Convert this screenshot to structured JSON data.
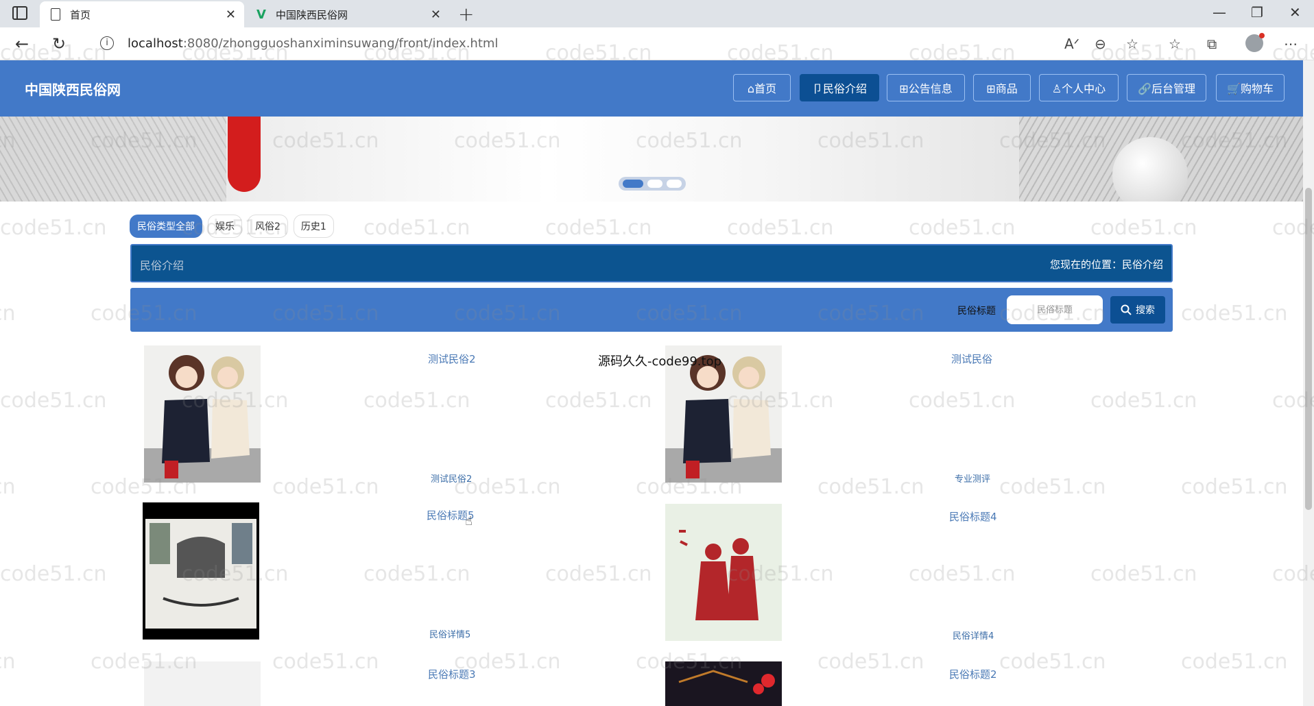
{
  "browser": {
    "tabs": [
      {
        "label": "首页",
        "active": true
      },
      {
        "label": "中国陕西民俗网",
        "active": false
      }
    ],
    "url_host": "localhost",
    "url_rest": ":8080/zhongguoshanximinsuwang/front/index.html"
  },
  "site": {
    "title": "中国陕西民俗网",
    "nav": [
      {
        "label": "⌂首页",
        "icon": "home-icon"
      },
      {
        "label": "卩民俗介绍",
        "icon": "flag-icon",
        "active": true
      },
      {
        "label": "⊞公告信息",
        "icon": "notice-icon"
      },
      {
        "label": "⊞商品",
        "icon": "shop-icon"
      },
      {
        "label": "♙个人中心",
        "icon": "user-icon"
      },
      {
        "label": "🔗后台管理",
        "icon": "link-icon"
      },
      {
        "label": "🛒购物车",
        "icon": "cart-icon"
      }
    ],
    "accent": "#4279c8",
    "accent_dark": "#0c4f93"
  },
  "banner": {
    "slides": 3,
    "current": 1
  },
  "types": [
    "民俗类型全部",
    "娱乐",
    "风俗2",
    "历史1"
  ],
  "section": {
    "title": "民俗介绍",
    "location_label": "您现在的位置：",
    "location_value": "民俗介绍"
  },
  "search": {
    "label": "民俗标题",
    "placeholder": "民俗标题",
    "button": "搜索"
  },
  "items": [
    {
      "title": "测试民俗2",
      "subtitle": "测试民俗2",
      "image": "anime-girls"
    },
    {
      "title": "测试民俗",
      "subtitle": "专业测评",
      "image": "anime-girls"
    },
    {
      "title": "民俗标题5",
      "subtitle": "民俗详情5",
      "image": "folk-culture-poster"
    },
    {
      "title": "民俗标题4",
      "subtitle": "民俗详情4",
      "image": "papercut"
    },
    {
      "title": "民俗标题3",
      "subtitle": "",
      "image": "blank"
    },
    {
      "title": "民俗标题2",
      "subtitle": "",
      "image": "night-lanterns"
    }
  ],
  "overlay_text": "源码久久-code99.top",
  "watermark": "code51.cn"
}
